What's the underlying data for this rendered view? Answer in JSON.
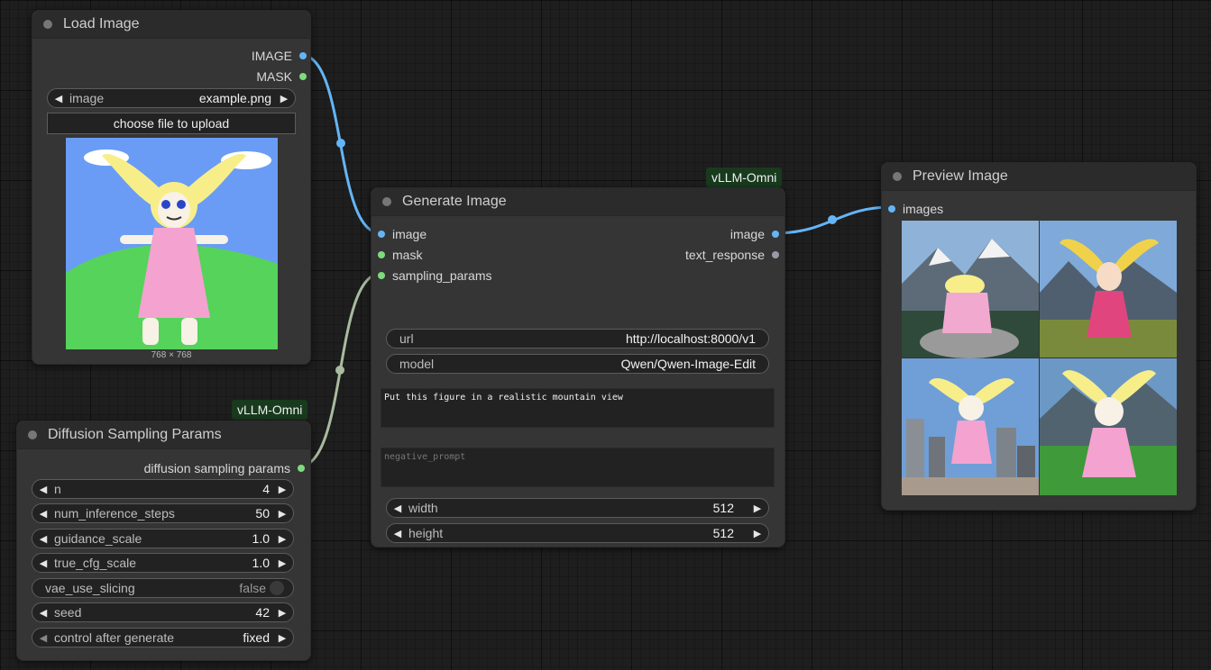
{
  "colors": {
    "image_wire": "#64b5f6",
    "params_wire": "#a9bba0",
    "badge_bg": "#183a1d"
  },
  "load_image": {
    "title": "Load Image",
    "outputs": [
      "IMAGE",
      "MASK"
    ],
    "image_widget": {
      "label": "image",
      "value": "example.png"
    },
    "upload_button": "choose file to upload",
    "dimensions": "768 × 768"
  },
  "diffusion_params": {
    "badge": "vLLM-Omni",
    "title": "Diffusion Sampling Params",
    "output": "diffusion sampling params",
    "widgets": [
      {
        "label": "n",
        "value": "4"
      },
      {
        "label": "num_inference_steps",
        "value": "50"
      },
      {
        "label": "guidance_scale",
        "value": "1.0"
      },
      {
        "label": "true_cfg_scale",
        "value": "1.0"
      },
      {
        "label": "vae_use_slicing",
        "value": "false"
      },
      {
        "label": "seed",
        "value": "42"
      },
      {
        "label": "control after generate",
        "value": "fixed"
      }
    ]
  },
  "generate_image": {
    "badge": "vLLM-Omni",
    "title": "Generate Image",
    "inputs": [
      "image",
      "mask",
      "sampling_params"
    ],
    "outputs": [
      "image",
      "text_response"
    ],
    "url": {
      "label": "url",
      "value": "http://localhost:8000/v1"
    },
    "model": {
      "label": "model",
      "value": "Qwen/Qwen-Image-Edit"
    },
    "prompt": "Put this figure in a realistic mountain view",
    "negative_prompt_placeholder": "negative_prompt",
    "width": {
      "label": "width",
      "value": "512"
    },
    "height": {
      "label": "height",
      "value": "512"
    }
  },
  "preview_image": {
    "title": "Preview Image",
    "input": "images"
  }
}
